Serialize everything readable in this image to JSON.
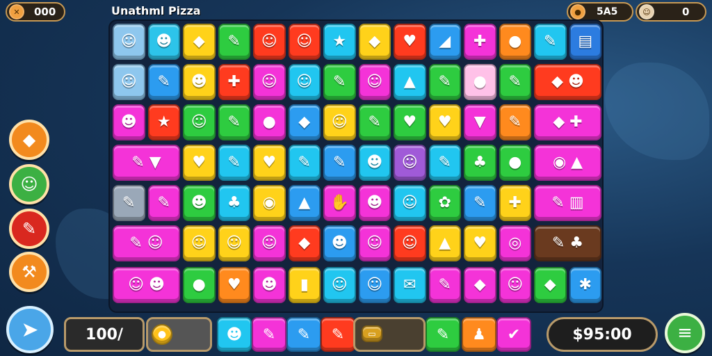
{
  "hud": {
    "title": "Unathml Pizza",
    "left_counter": "000",
    "right_counter_1": "5A5",
    "right_counter_2": "0",
    "left_counter_icon": "coin-icon",
    "right_counter_1_icon": "coin-icon",
    "right_counter_2_icon": "character-icon"
  },
  "side_buttons": [
    {
      "name": "eraser-button",
      "icon": "eraser-icon",
      "glyph": "◆",
      "color": "#f28a1e"
    },
    {
      "name": "character-button",
      "icon": "face-icon",
      "glyph": "☺",
      "color": "#3cb043"
    },
    {
      "name": "wrench-button",
      "icon": "wrench-icon",
      "glyph": "✎",
      "color": "#d9281f"
    },
    {
      "name": "hammer-button",
      "icon": "hammer-icon",
      "glyph": "⚒",
      "color": "#f28a1e"
    }
  ],
  "board": {
    "rows": [
      [
        [
          "#8ec7ee",
          "☺"
        ],
        [
          "#2dc4ea",
          "☻"
        ],
        [
          "#ffd21a",
          "◆"
        ],
        [
          "#2ecc40",
          "✎"
        ],
        [
          "#ff3b1f",
          "☺"
        ],
        [
          "#ff3b1f",
          "☺"
        ],
        [
          "#21c6f0",
          "★"
        ],
        [
          "#ffd21a",
          "◆"
        ],
        [
          "#ff3b1f",
          "♥"
        ],
        [
          "#2c9cf0",
          "◢"
        ],
        [
          "#f433d8",
          "✚"
        ],
        [
          "#ff8a1e",
          "●"
        ],
        [
          "#21c6f0",
          "✎"
        ],
        [
          "#2c7ce0",
          "▤"
        ]
      ],
      [
        [
          "#8ec7ee",
          "☺"
        ],
        [
          "#2c9cf0",
          "✎"
        ],
        [
          "#ffd21a",
          "☻"
        ],
        [
          "#ff3b1f",
          "✚"
        ],
        [
          "#f433d8",
          "☺"
        ],
        [
          "#21c6f0",
          "☺"
        ],
        [
          "#2ecc40",
          "✎"
        ],
        [
          "#f433d8",
          "☺"
        ],
        [
          "#21c6f0",
          "▲"
        ],
        [
          "#2ecc40",
          "✎"
        ],
        [
          "#ffc1e8",
          "●"
        ],
        [
          "#2ecc40",
          "✎"
        ],
        [
          "#ff3b1f",
          "◆ ☻"
        ]
      ],
      [
        [
          "#f433d8",
          "☻"
        ],
        [
          "#ff3b1f",
          "★"
        ],
        [
          "#2ecc40",
          "☺"
        ],
        [
          "#2ecc40",
          "✎"
        ],
        [
          "#f433d8",
          "●"
        ],
        [
          "#2c9cf0",
          "◆"
        ],
        [
          "#ffd21a",
          "☺"
        ],
        [
          "#2ecc40",
          "✎"
        ],
        [
          "#2ecc40",
          "♥"
        ],
        [
          "#ffd21a",
          "♥"
        ],
        [
          "#f433d8",
          "▼"
        ],
        [
          "#ff8a1e",
          "✎"
        ],
        [
          "#f433d8",
          "◆ ✚"
        ]
      ],
      [
        [
          "#f433d8",
          "✎ ▼"
        ],
        [
          "#ffd21a",
          "♥"
        ],
        [
          "#21c6f0",
          "✎"
        ],
        [
          "#ffd21a",
          "♥"
        ],
        [
          "#21c6f0",
          "✎"
        ],
        [
          "#2c9cf0",
          "✎"
        ],
        [
          "#21c6f0",
          "☻"
        ],
        [
          "#a05ad8",
          "☺"
        ],
        [
          "#21c6f0",
          "✎"
        ],
        [
          "#2ecc40",
          "♣"
        ],
        [
          "#2ecc40",
          "●"
        ],
        [
          "#f433d8",
          "◉ ▲"
        ]
      ],
      [
        [
          "#9aa8b8",
          "✎"
        ],
        [
          "#f433d8",
          "✎"
        ],
        [
          "#2ecc40",
          "☻"
        ],
        [
          "#21c6f0",
          "♣"
        ],
        [
          "#ffd21a",
          "◉"
        ],
        [
          "#2c9cf0",
          "▲"
        ],
        [
          "#f433d8",
          "✋"
        ],
        [
          "#f433d8",
          "☻"
        ],
        [
          "#21c6f0",
          "☺"
        ],
        [
          "#2ecc40",
          "✿"
        ],
        [
          "#2c9cf0",
          "✎"
        ],
        [
          "#ffd21a",
          "✚"
        ],
        [
          "#f433d8",
          "✎ ▥"
        ]
      ],
      [
        [
          "#f433d8",
          "✎ ☺"
        ],
        [
          "#ffd21a",
          "☺"
        ],
        [
          "#ffd21a",
          "☺"
        ],
        [
          "#f433d8",
          "☺"
        ],
        [
          "#ff3b1f",
          "◆"
        ],
        [
          "#2c9cf0",
          "☻"
        ],
        [
          "#f433d8",
          "☺"
        ],
        [
          "#ff3b1f",
          "☺"
        ],
        [
          "#ffd21a",
          "▲"
        ],
        [
          "#ffd21a",
          "♥"
        ],
        [
          "#f433d8",
          "◎"
        ],
        [
          "#6a3a1f",
          "✎ ♣"
        ]
      ],
      [
        [
          "#f433d8",
          "☺ ☻"
        ],
        [
          "#2ecc40",
          "●"
        ],
        [
          "#ff8a1e",
          "♥"
        ],
        [
          "#f433d8",
          "☻"
        ],
        [
          "#ffd21a",
          "▮"
        ],
        [
          "#21c6f0",
          "☺"
        ],
        [
          "#2c9cf0",
          "☺"
        ],
        [
          "#21c6f0",
          "✉"
        ],
        [
          "#f433d8",
          "✎"
        ],
        [
          "#f433d8",
          "◆"
        ],
        [
          "#f433d8",
          "☺"
        ],
        [
          "#2ecc40",
          "◆"
        ],
        [
          "#2c9cf0",
          "✱"
        ]
      ]
    ],
    "widths": [
      [
        1,
        1,
        1,
        1,
        1,
        1,
        1,
        1,
        1,
        1,
        1,
        1,
        1,
        1
      ],
      [
        1,
        1,
        1,
        1,
        1,
        1,
        1,
        1,
        1,
        1,
        1,
        1,
        2
      ],
      [
        1,
        1,
        1,
        1,
        1,
        1,
        1,
        1,
        1,
        1,
        1,
        1,
        2
      ],
      [
        2,
        1,
        1,
        1,
        1,
        1,
        1,
        1,
        1,
        1,
        1,
        2
      ],
      [
        1,
        1,
        1,
        1,
        1,
        1,
        1,
        1,
        1,
        1,
        1,
        1,
        2
      ],
      [
        2,
        1,
        1,
        1,
        1,
        1,
        1,
        1,
        1,
        1,
        1,
        2
      ],
      [
        2,
        1,
        1,
        1,
        1,
        1,
        1,
        1,
        1,
        1,
        1,
        1,
        1
      ]
    ]
  },
  "bottom": {
    "counter_left": "100/",
    "coin_slot_icon": "coin-icon",
    "tray": [
      {
        "color": "#21c6f0",
        "glyph": "☻",
        "icon": "cat-icon"
      },
      {
        "color": "#f433d8",
        "glyph": "✎",
        "icon": "brush-icon"
      },
      {
        "color": "#2c9cf0",
        "glyph": "✎",
        "icon": "marker-icon"
      },
      {
        "color": "#ff3b1f",
        "glyph": "✎",
        "icon": "pencil-icon"
      },
      {
        "color": "#2ecc40",
        "glyph": "✎",
        "icon": "carrot-icon"
      },
      {
        "color": "#ff8a1e",
        "glyph": "♟",
        "icon": "figure-icon"
      },
      {
        "color": "#f433d8",
        "glyph": "✔",
        "icon": "check-icon"
      }
    ],
    "score": "$95:00",
    "menu_icon": "menu-icon"
  }
}
